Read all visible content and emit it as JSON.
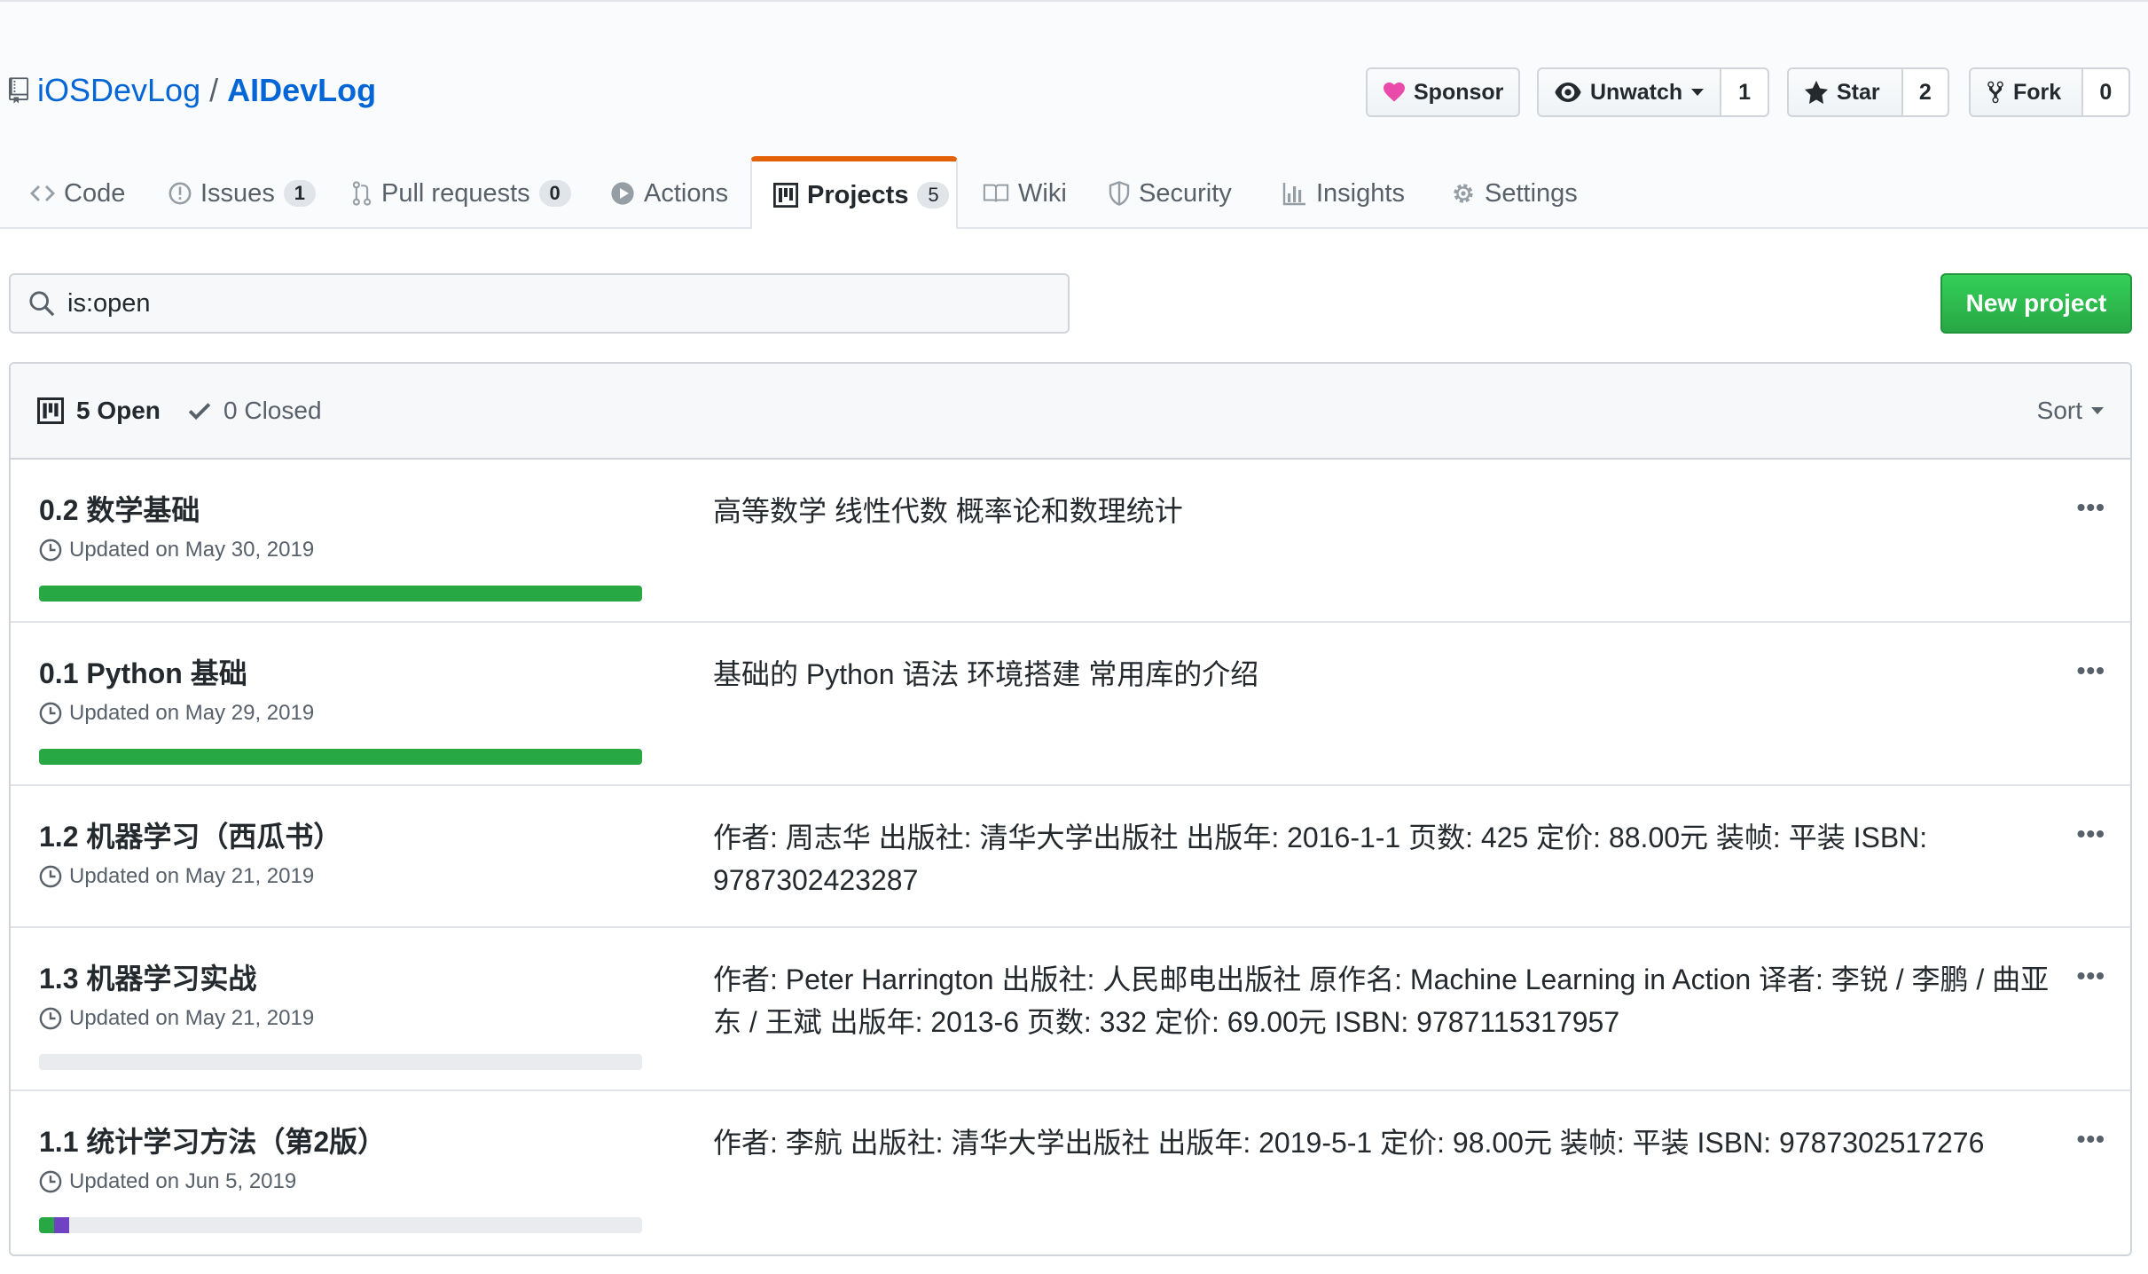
{
  "repo": {
    "owner": "iOSDevLog",
    "separator": "/",
    "name": "AIDevLog"
  },
  "actions": {
    "sponsor": {
      "label": "Sponsor"
    },
    "watch": {
      "label": "Unwatch",
      "count": "1"
    },
    "star": {
      "label": "Star",
      "count": "2"
    },
    "fork": {
      "label": "Fork",
      "count": "0"
    }
  },
  "tabs": [
    {
      "label": "Code",
      "icon": "code-icon"
    },
    {
      "label": "Issues",
      "count": "1",
      "icon": "issue-icon"
    },
    {
      "label": "Pull requests",
      "count": "0",
      "icon": "pull-request-icon"
    },
    {
      "label": "Actions",
      "icon": "play-icon"
    },
    {
      "label": "Projects",
      "count": "5",
      "icon": "project-icon",
      "selected": true
    },
    {
      "label": "Wiki",
      "icon": "book-icon"
    },
    {
      "label": "Security",
      "icon": "shield-icon"
    },
    {
      "label": "Insights",
      "icon": "graph-icon"
    },
    {
      "label": "Settings",
      "icon": "gear-icon"
    }
  ],
  "search": {
    "value": "is:open"
  },
  "new_project_label": "New project",
  "list_header": {
    "open": "5 Open",
    "closed": "0 Closed",
    "sort": "Sort"
  },
  "projects": [
    {
      "name": "0.2 数学基础",
      "updated": "Updated on May 30, 2019",
      "description": "高等数学 线性代数 概率论和数理统计",
      "progress": {
        "done": 1.0,
        "in_progress": 0
      }
    },
    {
      "name": "0.1 Python 基础",
      "updated": "Updated on May 29, 2019",
      "description": "基础的 Python 语法 环境搭建 常用库的介绍",
      "progress": {
        "done": 1.0,
        "in_progress": 0
      }
    },
    {
      "name": "1.2 机器学习（西瓜书）",
      "updated": "Updated on May 21, 2019",
      "description": "作者: 周志华 出版社: 清华大学出版社 出版年: 2016-1-1 页数: 425 定价: 88.00元 装帧: 平装 ISBN: 9787302423287",
      "progress": null
    },
    {
      "name": "1.3 机器学习实战",
      "updated": "Updated on May 21, 2019",
      "description": "作者: Peter Harrington 出版社: 人民邮电出版社 原作名: Machine Learning in Action 译者: 李锐 / 李鹏 / 曲亚东 / 王斌 出版年: 2013-6 页数: 332 定价: 69.00元 ISBN: 9787115317957",
      "progress": {
        "done": 0,
        "in_progress": 0
      }
    },
    {
      "name": "1.1 统计学习方法（第2版）",
      "updated": "Updated on Jun 5, 2019",
      "description": "作者: 李航 出版社: 清华大学出版社 出版年: 2019-5-1 定价: 98.00元 装帧: 平装 ISBN: 9787302517276",
      "progress": {
        "done": 0.025,
        "in_progress": 0.025
      }
    }
  ],
  "colors": {
    "link": "#0366d6",
    "done": "#28a745",
    "in_progress": "#6f42c1",
    "tab_accent": "#e36209",
    "sponsor_heart": "#ea4aaa"
  }
}
